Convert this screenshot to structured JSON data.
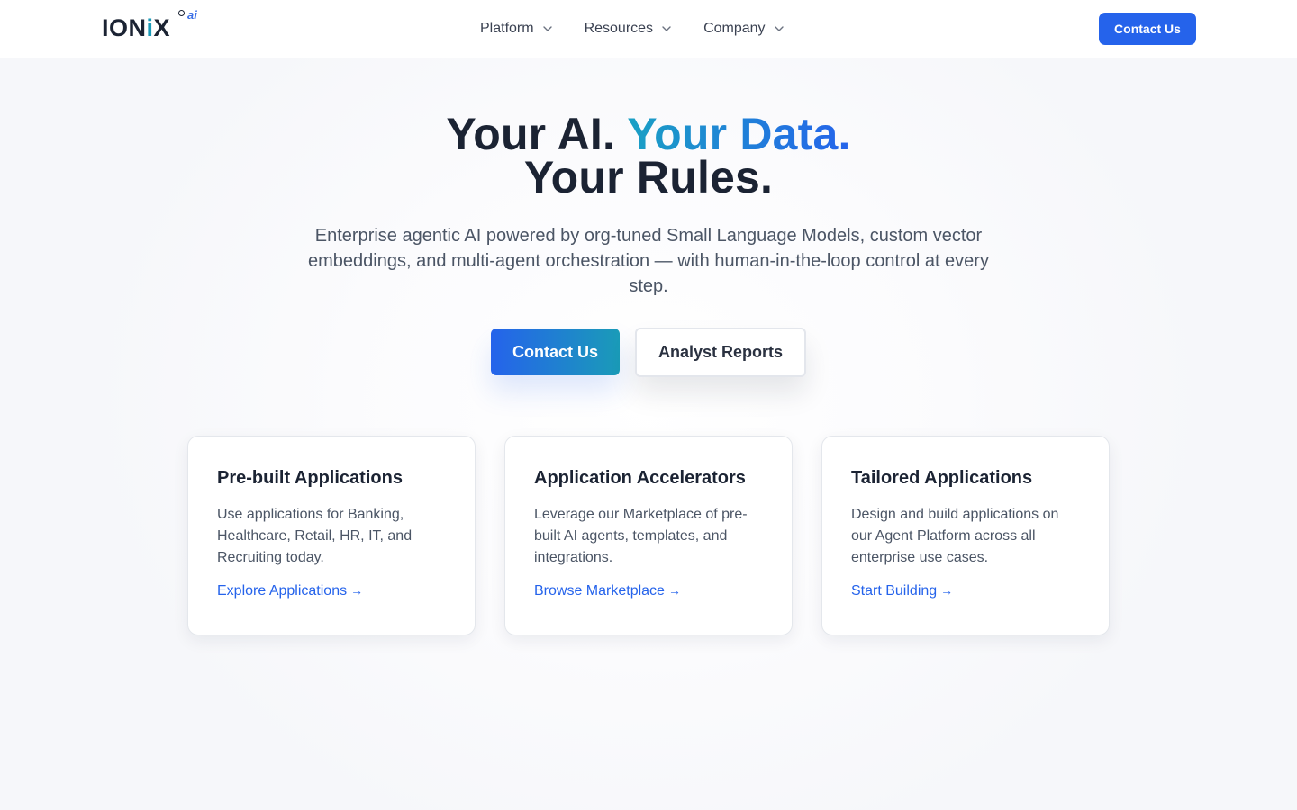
{
  "header": {
    "logo": {
      "text_main": "ION",
      "text_accent": "i",
      "text_end": "X",
      "superscript": "ai"
    },
    "nav": [
      {
        "label": "Platform",
        "icon": "chevron-down-icon"
      },
      {
        "label": "Resources",
        "icon": "chevron-down-icon"
      },
      {
        "label": "Company",
        "icon": "chevron-down-icon"
      }
    ],
    "cta_label": "Contact Us"
  },
  "hero": {
    "title_part1": "Your AI.",
    "title_accent": "Your Data.",
    "title_line2": "Your Rules.",
    "subtitle": "Enterprise agentic AI powered by org-tuned Small Language Models, custom vector embeddings, and multi-agent orchestration — with human-in-the-loop control at every step.",
    "primary_button": "Contact Us",
    "secondary_button": "Analyst Reports"
  },
  "cards": [
    {
      "title": "Pre-built Applications",
      "description": "Use applications for Banking, Healthcare, Retail, HR, IT, and Recruiting today.",
      "link": "Explore Applications",
      "arrow": "→"
    },
    {
      "title": "Application Accelerators",
      "description": "Leverage our Marketplace of pre-built AI agents, templates, and integrations.",
      "link": "Browse Marketplace",
      "arrow": "→"
    },
    {
      "title": "Tailored Applications",
      "description": "Design and build applications on our Agent Platform across all enterprise use cases.",
      "link": "Start Building",
      "arrow": "→"
    }
  ],
  "colors": {
    "primary": "#2563eb",
    "accent_teal": "#1a9bb8",
    "text_dark": "#1b2333",
    "text_muted": "#4b5565"
  }
}
